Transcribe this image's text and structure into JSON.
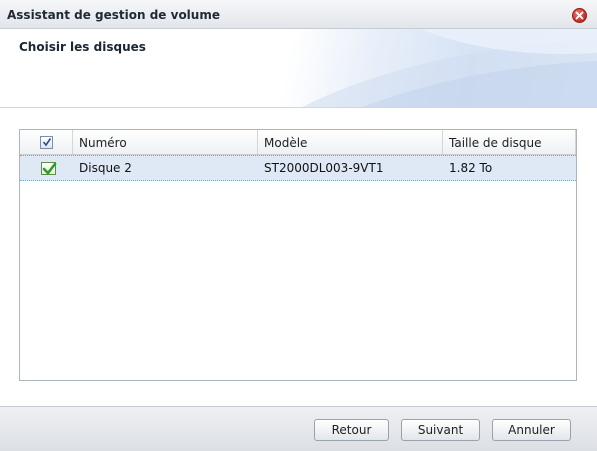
{
  "window": {
    "title": "Assistant de gestion de volume"
  },
  "header": {
    "step_title": "Choisir les disques"
  },
  "table": {
    "columns": {
      "select_all_checked": true,
      "number": "Numéro",
      "model": "Modèle",
      "size": "Taille de disque"
    },
    "rows": [
      {
        "checked": true,
        "selected": true,
        "number": "Disque 2",
        "model": "ST2000DL003-9VT1",
        "size": "1.82 To"
      }
    ]
  },
  "footer": {
    "back_label": "Retour",
    "next_label": "Suivant",
    "cancel_label": "Annuler"
  },
  "colors": {
    "row_selected_bg": "#dfe9f6",
    "check_green": "#2e9b2a",
    "close_red": "#c62a22"
  }
}
